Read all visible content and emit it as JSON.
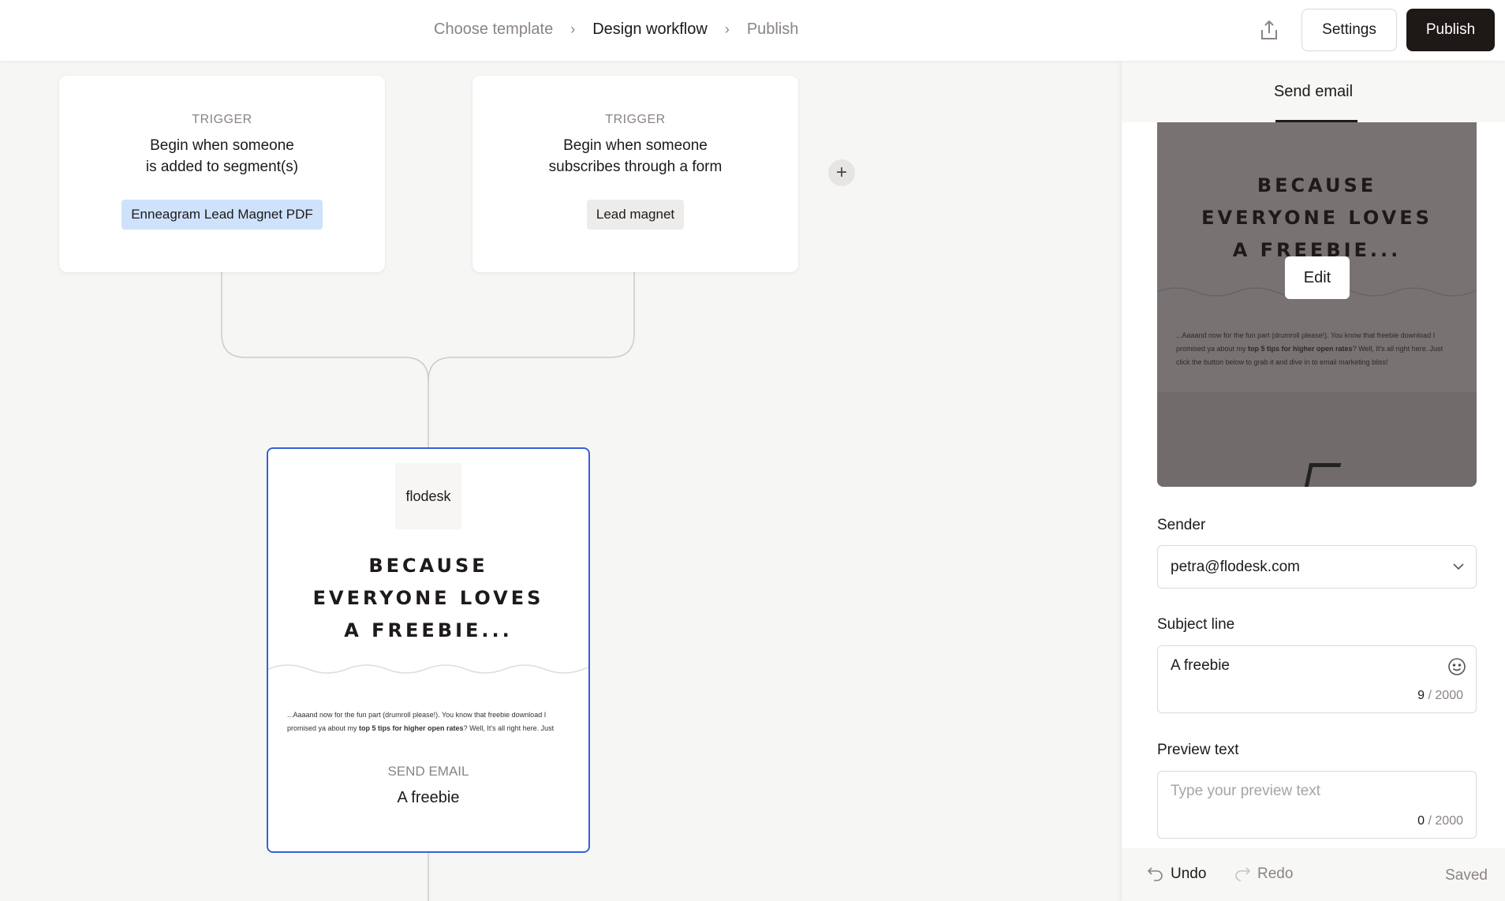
{
  "header": {
    "breadcrumbs": [
      "Choose template",
      "Design workflow",
      "Publish"
    ],
    "settings_label": "Settings",
    "publish_label": "Publish"
  },
  "canvas": {
    "triggers": [
      {
        "label": "TRIGGER",
        "line1": "Begin when someone",
        "line2": "is added to segment(s)",
        "tag": "Enneagram Lead Magnet PDF"
      },
      {
        "label": "TRIGGER",
        "line1": "Begin when someone",
        "line2": "subscribes through a form",
        "tag": "Lead magnet"
      }
    ],
    "add_label": "+",
    "email": {
      "logo": "flodesk",
      "headline": [
        "BECAUSE",
        "EVERYONE LOVES",
        "A FREEBIE..."
      ],
      "body1": "...Aaaand now for the fun part (drumroll please!). You know that freebie download I promised ya about my ",
      "body_bold": "top 5 tips for higher open rates",
      "body2": "? Well, It's all right here. Just click the button below to grab it and dive in to email marketing bliss!",
      "type_label": "SEND EMAIL",
      "subject": "A freebie"
    }
  },
  "panel": {
    "tab": "Send email",
    "edit_label": "Edit",
    "sender_label": "Sender",
    "sender_value": "petra@flodesk.com",
    "subject_label": "Subject line",
    "subject_value": "A freebie",
    "subject_count": "9",
    "subject_max": " / 2000",
    "preview_label": "Preview text",
    "preview_placeholder": "Type your preview text",
    "preview_count": "0",
    "preview_max": " / 2000",
    "undo": "Undo",
    "redo": "Redo",
    "status": "Saved"
  },
  "colors": {
    "accent": "#3461d6",
    "tag_blue": "#cfe2fb",
    "dark": "#1e1817"
  }
}
